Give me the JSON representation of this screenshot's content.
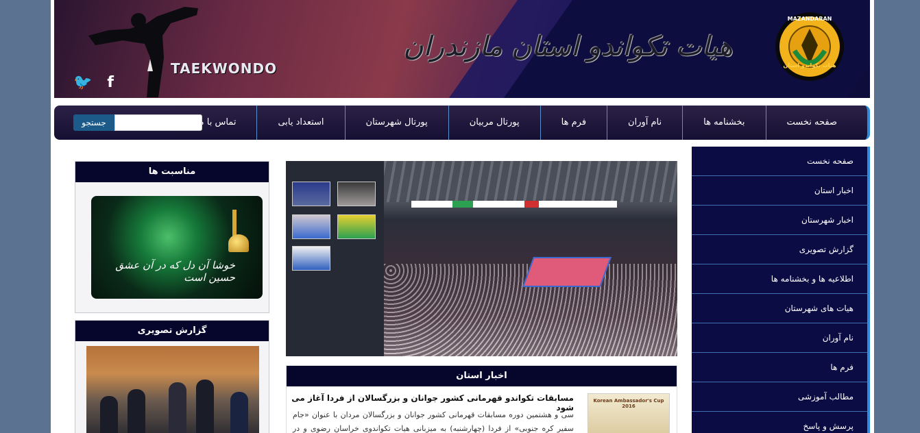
{
  "header": {
    "title": "هیات تکواندو استان مازندران",
    "brand": "TAEKWONDO",
    "logo_caption": "هیات تکواندو استان",
    "social": [
      {
        "icon": "twitter-icon",
        "glyph": "🐦"
      },
      {
        "icon": "facebook-icon",
        "glyph": "f"
      }
    ]
  },
  "nav": {
    "items": [
      "صفحه نخست",
      "بخشنامه ها",
      "نام آوران",
      "فرم ها",
      "پورتال مربیان",
      "پورتال شهرستان",
      "استعداد یابی",
      "تماس با ما"
    ],
    "search_button": "جستجو",
    "search_placeholder": ""
  },
  "right_menu": {
    "items": [
      "صفحه نخست",
      "اخبار استان",
      "اخبار شهرستان",
      "گزارش تصویری",
      "اطلاعیه ها و بخشنامه ها",
      "هیات های شهرستان",
      "نام آوران",
      "فرم ها",
      "مطالب آموزشی",
      "پرسش و پاسخ"
    ]
  },
  "left_boxes": {
    "occasions_title": "مناسبت ها",
    "occasion_text": "خوشا آن دل که در آن عشق حسین است",
    "photo_report_title": "گزارش تصویری"
  },
  "news": {
    "title": "اخبار استان",
    "headline": "مسابقات تکواندو قهرمانی کشور جوانان و بزرگسالان از فردا آغاز می شود",
    "body": "سی و هشتمین دوره مسابقات قهرمانی کشور جوانان و بزرگسالان مردان با عنوان «جام سفیر کره جنوبی» از فردا (چهارشنبه) به میزبانی هیات تکواندوی خراسان رضوی و در مجموعه ورزشی",
    "image_caption": "Korean Ambassador's Cup 2016"
  },
  "colors": {
    "page_bg": "#5b7290",
    "nav_bg": "#151033",
    "menu_bg": "#0c0c44",
    "accent": "#2d8bd8",
    "header_bar": "#06052c"
  }
}
